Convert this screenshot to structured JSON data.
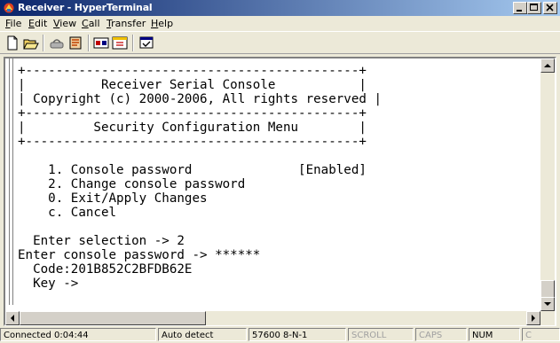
{
  "window": {
    "title": "Receiver - HyperTerminal",
    "controls": [
      "minimize-icon",
      "maximize-icon",
      "close-icon"
    ]
  },
  "menu": {
    "items": [
      {
        "label": "File",
        "underline": "F",
        "rest": "ile"
      },
      {
        "label": "Edit",
        "underline": "E",
        "rest": "dit"
      },
      {
        "label": "View",
        "underline": "V",
        "rest": "iew"
      },
      {
        "label": "Call",
        "underline": "C",
        "rest": "all"
      },
      {
        "label": "Transfer",
        "underline": "T",
        "rest": "ransfer"
      },
      {
        "label": "Help",
        "underline": "H",
        "rest": "elp"
      }
    ]
  },
  "toolbar": {
    "buttons": [
      "new-connection-icon",
      "open-icon",
      "connect-icon",
      "disconnect-icon",
      "send-icon",
      "receive-icon",
      "properties-icon"
    ]
  },
  "terminal": {
    "lines": [
      "+--------------------------------------------+",
      "|          Receiver Serial Console           |",
      "| Copyright (c) 2000-2006, All rights reserved |",
      "+--------------------------------------------+",
      "|         Security Configuration Menu        |",
      "+--------------------------------------------+",
      "",
      "    1. Console password              [Enabled]",
      "    2. Change console password",
      "    0. Exit/Apply Changes",
      "    c. Cancel",
      "",
      "  Enter selection -> 2",
      "Enter console password -> ******",
      "  Code:201B852C2BFDB62E",
      "  Key ->"
    ]
  },
  "status": {
    "connected": "Connected 0:04:44",
    "detect": "Auto detect",
    "settings": "57600 8-N-1",
    "scroll": "SCROLL",
    "caps": "CAPS",
    "num": "NUM",
    "capture": "C"
  }
}
